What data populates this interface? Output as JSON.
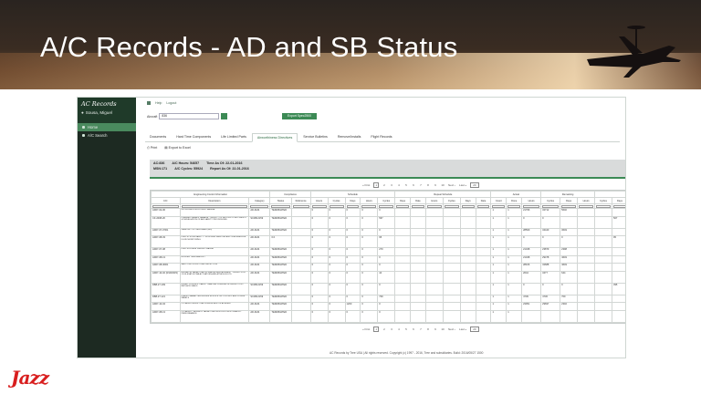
{
  "slide": {
    "title": "A/C Records - AD and SB Status",
    "logo_text": "Jazz"
  },
  "app": {
    "name": "AC Records",
    "user": "Sousa, Miguel",
    "toplinks": [
      "Help",
      "Logout"
    ],
    "aircraft_label": "Aircraft",
    "aircraft_value": "836",
    "export_label": "Export Spec2500"
  },
  "sidebar": {
    "items": [
      {
        "label": "Home",
        "icon": "home-icon",
        "active": true
      },
      {
        "label": "A/C Search",
        "icon": "search-icon",
        "active": false
      }
    ]
  },
  "tabs": [
    "Documents",
    "Hard Time Components",
    "Life Limited Parts",
    "Airworthiness Directives",
    "Service Bulletins",
    "Remove/Installs",
    "Flight Records"
  ],
  "active_tab": 3,
  "subtools": [
    "Print",
    "Export to Excel"
  ],
  "summary": {
    "row1": [
      "AC:836",
      "A/C Hours: 54657",
      "Time As Of: 22-01-2016"
    ],
    "row2": [
      "MSN:171",
      "A/C Cycles: 55924",
      "Report As Of: 22-01-2016"
    ]
  },
  "pager": {
    "first": "« First",
    "pages": [
      "1",
      "2",
      "3",
      "4",
      "5",
      "6",
      "7",
      "8",
      "9",
      "10"
    ],
    "current": "1",
    "next": "Next ›",
    "last": "Last »",
    "page_size": "20"
  },
  "grid": {
    "group_headers": [
      "Engineering Control Information",
      "Compliance",
      "Schedule",
      "Repeat Schedule",
      "Actual",
      "Remaining"
    ],
    "columns": [
      "C/C",
      "Description",
      "Category",
      "Status",
      "Reference",
      "Hours",
      "Cycles",
      "Days",
      "Hours",
      "Cycles",
      "Days",
      "Date",
      "Hours",
      "Cycles",
      "Days",
      "Date",
      "Count",
      "Done",
      "Hours",
      "Cycles",
      "Days",
      "Hours",
      "Cycles",
      "Days"
    ],
    "rows": [
      [
        "AD07-02-06",
        "DE 03-03 ACF-ND3 FLIGHT MANUAL",
        "AD-DHS",
        "TERMINATED",
        "",
        "0",
        "0",
        "0",
        "0",
        "0",
        "",
        "",
        "",
        "",
        "",
        "",
        "1",
        "1",
        "21796",
        "32712",
        "5640",
        "",
        "",
        ""
      ],
      [
        "CF-2008-26",
        "PLANNED SHEATH DAMAGE - INSPECT OF RECORD COMPONENTS & INSTALLATION OF AIR SAFETY PROCEDURES",
        "SCDB-0159",
        "TERMINATED",
        "",
        "0",
        "0",
        "0",
        "0",
        "567",
        "",
        "",
        "",
        "",
        "",
        "",
        "1",
        "1",
        "0",
        "0",
        "",
        "",
        "",
        "567"
      ],
      [
        "AD07-07-07R1",
        "LAVATORY OXYGEN LABEL (AD)",
        "AD-DHS",
        "TERMINATED",
        "",
        "0",
        "0",
        "0",
        "0",
        "0",
        "",
        "",
        "",
        "",
        "",
        "",
        "1",
        "1",
        "28569",
        "34440",
        "3649",
        "",
        "",
        ""
      ],
      [
        "AD07-08-03",
        "FUEL SYSTEM SAFETY - NITROGEN INERTING AND TEMPERATURE FLUID MONITORING",
        "AD-DHS",
        "0.0",
        "",
        "0",
        "0",
        "0",
        "0",
        "95",
        "",
        "",
        "",
        "",
        "",
        "",
        "1",
        "1",
        "0",
        "0",
        "0",
        "",
        "",
        "95"
      ],
      [
        "AD07-07-08",
        "FUEL SPILLAGE WIRING CHANGE",
        "AD-DHS",
        "TERMINATED",
        "",
        "0",
        "0",
        "0",
        "0",
        "270",
        "",
        "",
        "",
        "",
        "",
        "",
        "1",
        "1",
        "21348",
        "23879",
        "2398",
        "",
        "",
        ""
      ],
      [
        "AD07-08-13",
        "RUDDER TRIM BRACKET",
        "AD-DHS",
        "TERMINATED",
        "",
        "0",
        "0",
        "0",
        "0",
        "0",
        "",
        "",
        "",
        "",
        "",
        "",
        "1",
        "1",
        "21348",
        "29478",
        "4649",
        "",
        "",
        ""
      ],
      [
        "AD07-08-06R1",
        "FAN COWL STRUCTURE INSPECTION",
        "AD-DHS",
        "TERMINATED",
        "",
        "0",
        "0",
        "0",
        "0",
        "0",
        "",
        "",
        "",
        "",
        "",
        "",
        "1",
        "1",
        "28166",
        "32688",
        "4649",
        "",
        "",
        ""
      ],
      [
        "AD07-10-02 (R1/R2/R3)",
        "ELEVATOR TAB ACTUATOR SPACER REPLACEMENT - INSPECTION OF ELEVATOR TAB ACTUATORS AND ATTACH BOLTS",
        "AD-DHS",
        "TERMINATED",
        "",
        "0",
        "0",
        "0",
        "0",
        "44",
        "",
        "",
        "",
        "",
        "",
        "",
        "1",
        "1",
        "2644",
        "3477",
        "644",
        "",
        "",
        ""
      ],
      [
        "DB8-27-109",
        "FLIGHT CONTROL CABLE - SEALS ACCUMULATOR INSPECTION - REPLACE SEALS",
        "SCDB-0159",
        "TERMINATED",
        "",
        "0",
        "0",
        "0",
        "0",
        "0",
        "",
        "",
        "",
        "",
        "",
        "",
        "1",
        "1",
        "0",
        "0",
        "0",
        "",
        "",
        "395"
      ],
      [
        "DB8-27-121",
        "PLACE CHARACTER BUFFER MODULE ON CONTROL AND POWER PANELS",
        "SCDB-0159",
        "TERMINATED",
        "",
        "0",
        "0",
        "0",
        "0",
        "709",
        "",
        "",
        "",
        "",
        "",
        "",
        "1",
        "1",
        "4739",
        "4736",
        "709",
        "",
        "",
        ""
      ],
      [
        "AD07-10-04",
        "C/O ALERT RESULT FAIL & REINSTATE OF AD ALERT",
        "AD-DHS",
        "TERMINATED",
        "",
        "0",
        "0",
        "1200",
        "0",
        "0",
        "",
        "",
        "",
        "",
        "",
        "",
        "1",
        "1",
        "23051",
        "29697",
        "2302",
        "",
        "",
        ""
      ],
      [
        "AD07-08-13",
        "C/O ALERT - REWRITE TAB ACTUATOR RODS FOR HYDRAULIC PERFORMANCE",
        "AD-DHS",
        "TERMINATED",
        "",
        "0",
        "0",
        "0",
        "0",
        "0",
        "",
        "",
        "",
        "",
        "",
        "",
        "1",
        "1",
        "",
        "",
        "",
        "",
        "",
        ""
      ]
    ]
  },
  "footer": "AC Records by Tree USA | All rights reserved. Copyright (c) 1997 - 2016, Tree and subsidiaries. Build: 2016/05/27 1500"
}
